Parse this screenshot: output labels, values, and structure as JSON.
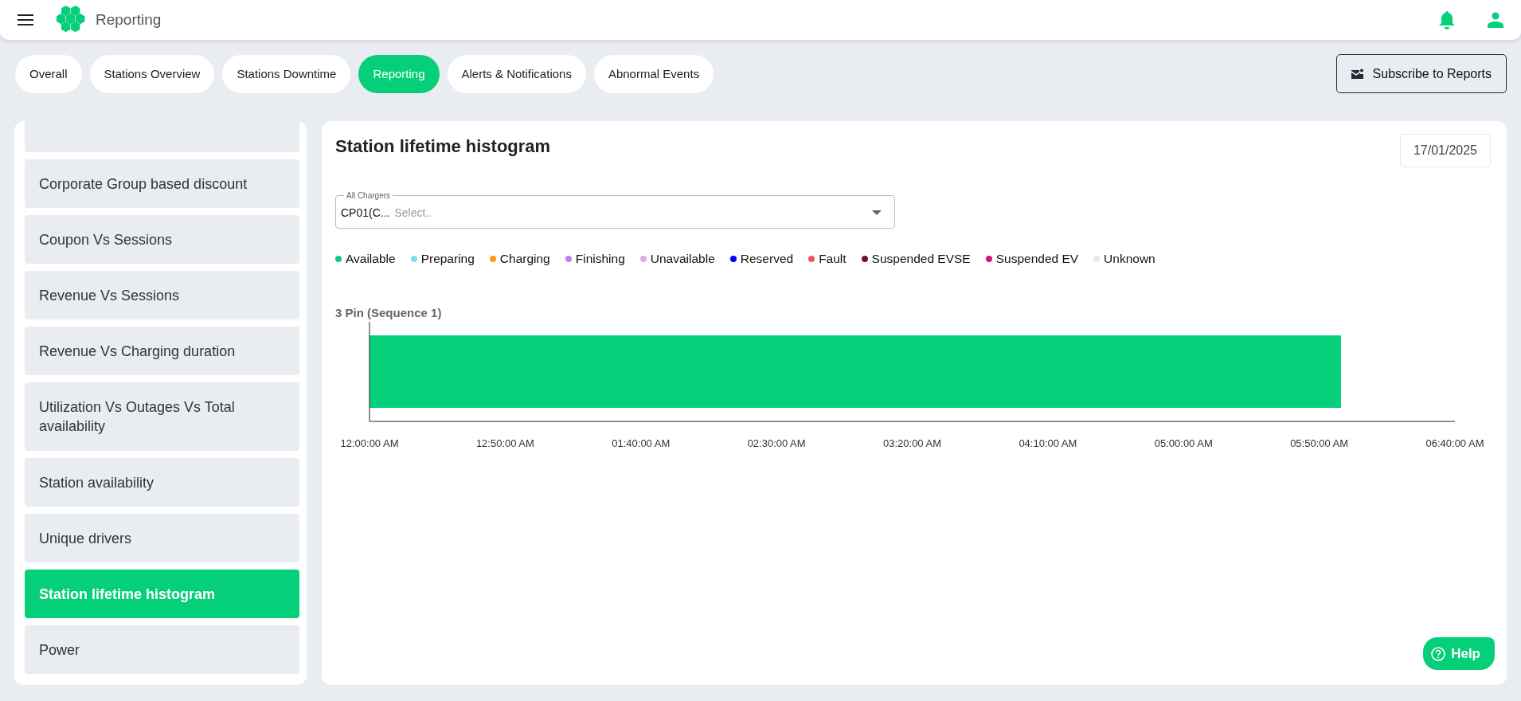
{
  "header": {
    "title": "Reporting"
  },
  "tabs": [
    {
      "label": "Overall",
      "selected": false
    },
    {
      "label": "Stations Overview",
      "selected": false
    },
    {
      "label": "Stations Downtime",
      "selected": false
    },
    {
      "label": "Reporting",
      "selected": true
    },
    {
      "label": "Alerts & Notifications",
      "selected": false
    },
    {
      "label": "Abnormal Events",
      "selected": false
    }
  ],
  "subscribe_button": "Subscribe to Reports",
  "sidebar": {
    "items": [
      {
        "label": "Corporate Group based discount",
        "selected": false
      },
      {
        "label": "Coupon Vs Sessions",
        "selected": false
      },
      {
        "label": "Revenue Vs Sessions",
        "selected": false
      },
      {
        "label": "Revenue Vs Charging duration",
        "selected": false
      },
      {
        "label": "Utilization Vs Outages Vs Total availability",
        "selected": false
      },
      {
        "label": "Station availability",
        "selected": false
      },
      {
        "label": "Unique drivers",
        "selected": false
      },
      {
        "label": "Station lifetime histogram",
        "selected": true
      },
      {
        "label": "Power",
        "selected": false
      }
    ]
  },
  "panel": {
    "title": "Station lifetime histogram",
    "date": "17/01/2025",
    "charger_select": {
      "label": "All Chargers",
      "value": "CP01(C...",
      "placeholder": "Select.."
    },
    "legend": [
      {
        "label": "Available",
        "color": "#0acf7b"
      },
      {
        "label": "Preparing",
        "color": "#72e3ef"
      },
      {
        "label": "Charging",
        "color": "#f59e0b"
      },
      {
        "label": "Finishing",
        "color": "#c77df3"
      },
      {
        "label": "Unavailable",
        "color": "#eaa6d8"
      },
      {
        "label": "Reserved",
        "color": "#0000ff"
      },
      {
        "label": "Fault",
        "color": "#e85a5a"
      },
      {
        "label": "Suspended EVSE",
        "color": "#6b0f3e"
      },
      {
        "label": "Suspended EV",
        "color": "#c8177d"
      },
      {
        "label": "Unknown",
        "color": "#e5e7eb"
      }
    ],
    "chart_data": {
      "type": "bar",
      "orientation": "horizontal",
      "title": "3 Pin (Sequence 1)",
      "series": [
        {
          "color": "#06cf7a",
          "values": [
            358
          ]
        }
      ],
      "xlim": [
        0,
        400
      ],
      "xticks": [
        {
          "value": 0,
          "label": "12:00:00 AM"
        },
        {
          "value": 50,
          "label": "12:50:00 AM"
        },
        {
          "value": 100,
          "label": "01:40:00 AM"
        },
        {
          "value": 150,
          "label": "02:30:00 AM"
        },
        {
          "value": 200,
          "label": "03:20:00 AM"
        },
        {
          "value": 250,
          "label": "04:10:00 AM"
        },
        {
          "value": 300,
          "label": "05:00:00 AM"
        },
        {
          "value": 350,
          "label": "05:50:00 AM"
        },
        {
          "value": 400,
          "label": "06:40:00 AM"
        }
      ]
    }
  },
  "help_button": "Help"
}
